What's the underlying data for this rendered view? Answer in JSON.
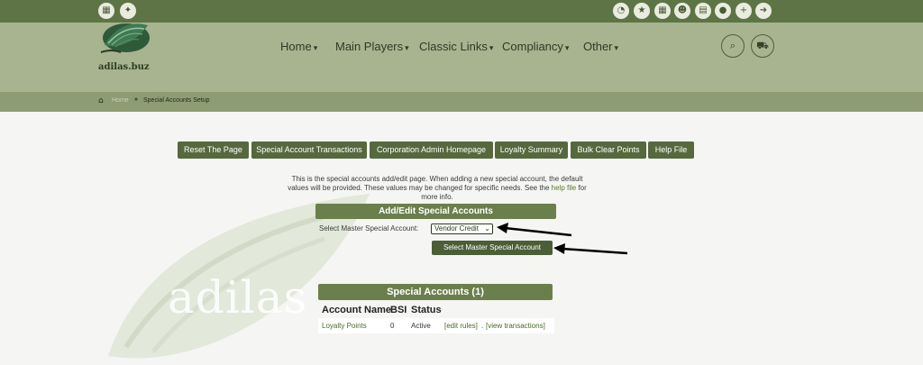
{
  "topbar": {
    "left_icons": [
      "building-icon",
      "magic-wand-icon"
    ],
    "right_icons": [
      "gauge-icon",
      "star-icon",
      "building-icon",
      "users-icon",
      "calendar-icon",
      "user-icon",
      "user-plus-icon",
      "logout-icon"
    ]
  },
  "header": {
    "logo_text": "adilas.buz",
    "nav": [
      {
        "label": "Home"
      },
      {
        "label": "Main Players"
      },
      {
        "label": "Classic Links"
      },
      {
        "label": "Compliancy"
      },
      {
        "label": "Other"
      }
    ],
    "icons": [
      "search-icon",
      "cart-icon"
    ]
  },
  "breadcrumb": {
    "home_label": "Home",
    "current": "Special Accounts Setup"
  },
  "actions": [
    {
      "label": "Reset The Page"
    },
    {
      "label": "Special Account Transactions"
    },
    {
      "label": "Corporation Admin Homepage"
    },
    {
      "label": "Loyalty Summary"
    },
    {
      "label": "Bulk Clear Points"
    },
    {
      "label": "Help File"
    }
  ],
  "intro": {
    "line1": "This is the special accounts add/edit page. When adding a new special account, the default",
    "line2a": "values will be provided. These values may be changed for specific needs. See the ",
    "link": "help file",
    "line2b": " for",
    "line3": "more info."
  },
  "add_edit": {
    "title": "Add/Edit Special Accounts",
    "select_label": "Select Master Special Account:",
    "select_value": "Vendor Credit",
    "button": "Select Master Special Account"
  },
  "watermark_text": "adilas",
  "special_accounts": {
    "title": "Special Accounts (1)",
    "columns": [
      "Account Name",
      "BSI",
      "Status"
    ],
    "rows": [
      {
        "name": "Loyalty Points",
        "bsi": "0",
        "status": "Active",
        "edit": "[edit rules]",
        "sep": ".",
        "view": "[view transactions]"
      }
    ]
  },
  "colors": {
    "topbar": "#5e7446",
    "header": "#a7b48f",
    "crumbbar": "#8e9c74",
    "button": "#55693d",
    "section_head": "#6b7f4c"
  }
}
